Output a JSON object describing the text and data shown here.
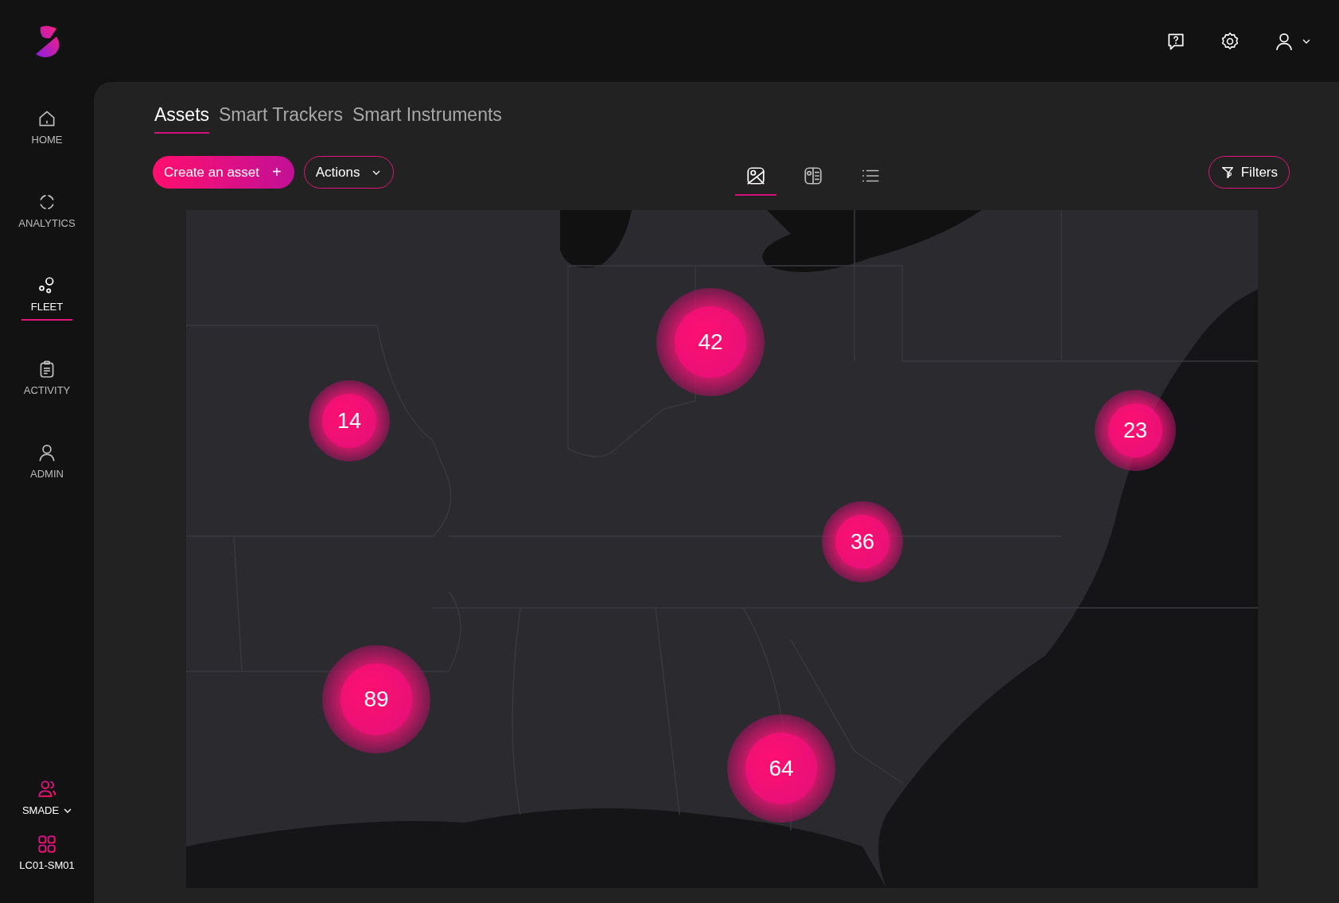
{
  "sidebar": {
    "items": [
      {
        "label": "HOME",
        "selected": false
      },
      {
        "label": "ANALYTICS",
        "selected": false
      },
      {
        "label": "FLEET",
        "selected": true
      },
      {
        "label": "ACTIVITY",
        "selected": false
      },
      {
        "label": "ADMIN",
        "selected": false
      }
    ],
    "account": {
      "label": "SMADE"
    },
    "site": {
      "label": "LC01-SM01"
    }
  },
  "tabs": [
    {
      "label": "Assets",
      "selected": true
    },
    {
      "label": "Smart Trackers",
      "selected": false
    },
    {
      "label": "Smart Instruments",
      "selected": false
    }
  ],
  "toolbar": {
    "create_button": "Create an asset",
    "create_icon": "+",
    "actions_button": "Actions",
    "filters_button": "Filters",
    "views": [
      {
        "kind": "map",
        "selected": true
      },
      {
        "kind": "split",
        "selected": false
      },
      {
        "kind": "list",
        "selected": false
      }
    ]
  },
  "map": {
    "clusters": [
      {
        "count": "42"
      },
      {
        "count": "14"
      },
      {
        "count": "23"
      },
      {
        "count": "36"
      },
      {
        "count": "89"
      },
      {
        "count": "64"
      }
    ]
  }
}
